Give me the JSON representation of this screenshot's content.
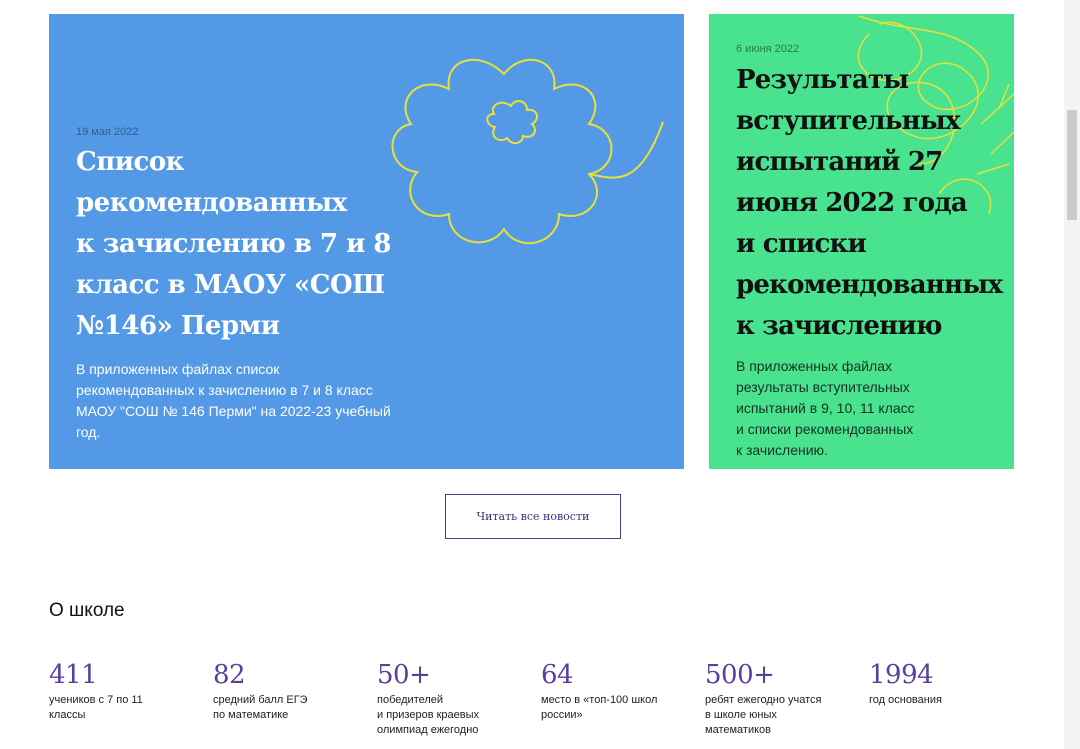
{
  "news": [
    {
      "date": "19 мая 2022",
      "title": "Список\nрекомендованных\nк зачислению в 7 и 8\nкласс в МАОУ «СОШ\n№146» Перми",
      "description": "В приложенных файлах список\nрекомендованных к зачислению в 7 и 8 класс\nМАОУ \"СОШ № 146 Перми\" на 2022-23 учебный\nгод.",
      "background": "#5499e5"
    },
    {
      "date": "6 июня 2022",
      "title": "Результаты\nвступительных\nиспытаний 27\nиюня 2022 года\nи списки\nрекомендованных\nк зачислению",
      "description": "В приложенных файлах\nрезультаты вступительных\nиспытаний в 9, 10, 11 класс\nи списки рекомендованных\nк зачислению.",
      "background": "#49e28f"
    }
  ],
  "read_all_label": "Читать все новости",
  "about": {
    "heading": "О школе",
    "stats": [
      {
        "value": "411",
        "label": "учеников с 7 по 11\nклассы"
      },
      {
        "value": "82",
        "label": "средний балл ЕГЭ\nпо математике"
      },
      {
        "value": "50+",
        "label": "победителей\nи призеров краевых\nолимпиад ежегодно"
      },
      {
        "value": "64",
        "label": "место в «топ-100 школ\nроссии»"
      },
      {
        "value": "500+",
        "label": "ребят ежегодно учатся\nв школе юных\nматематиков"
      },
      {
        "value": "1994",
        "label": "год основания"
      }
    ]
  },
  "colors": {
    "accent": "#5a3fa0",
    "doodle": "#e8e03a"
  }
}
